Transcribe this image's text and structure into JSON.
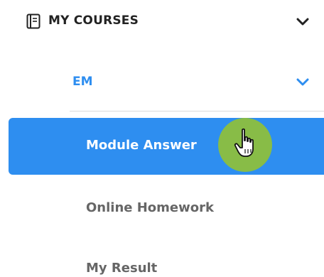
{
  "nav": {
    "section": {
      "title": "MY COURSES",
      "icon": "notebook-icon",
      "toggle_icon": "chevron-down-icon"
    },
    "course": {
      "label": "EM",
      "toggle_icon": "chevron-down-icon",
      "accent_color": "#2e8ef0"
    },
    "items": [
      {
        "label": "Module Answer",
        "active": true
      },
      {
        "label": "Online Homework",
        "active": false
      },
      {
        "label": "My Result",
        "active": false
      }
    ]
  },
  "cursor": {
    "icon": "hand-pointer-icon",
    "highlight_color": "#8dbf3d"
  },
  "colors": {
    "active_bg": "#2e8ef0",
    "active_text": "#ffffff",
    "inactive_text": "#666666",
    "header_text": "#222222"
  }
}
